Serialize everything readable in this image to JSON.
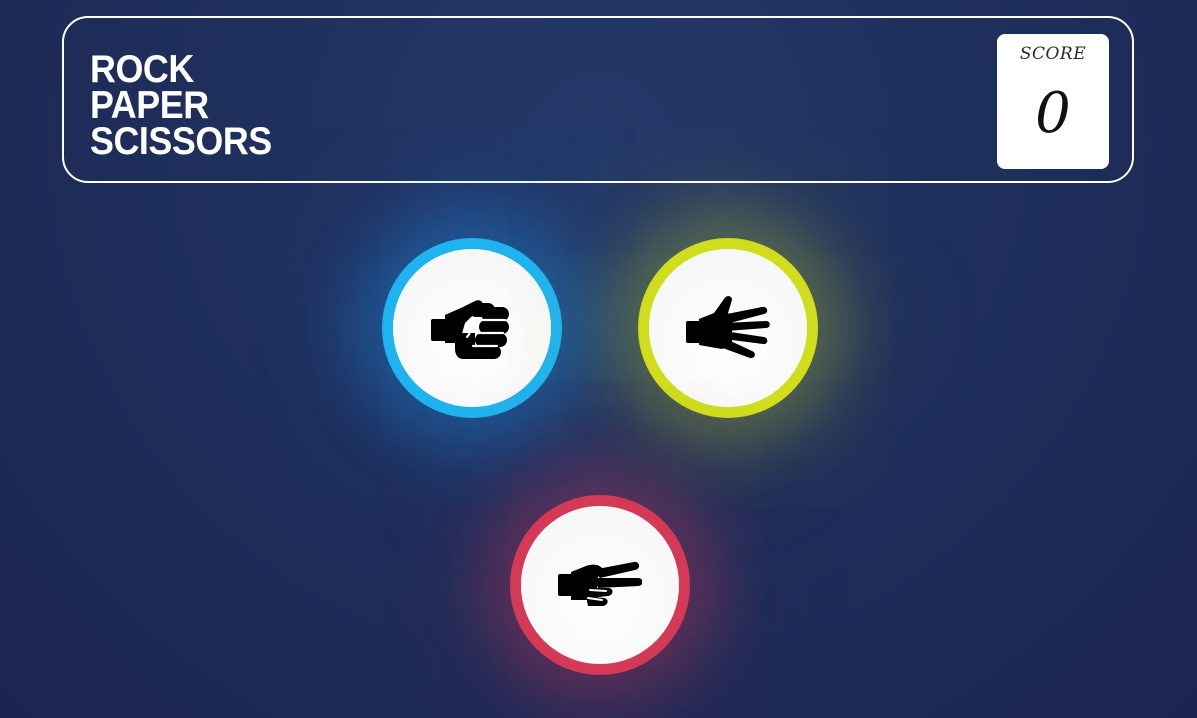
{
  "header": {
    "title_lines": [
      "ROCK",
      "PAPER",
      "SCISSORS"
    ],
    "score_label": "SCORE",
    "score_value": "0"
  },
  "choices": [
    {
      "id": "rock",
      "icon": "fist-icon",
      "ring_color": "#1fb4ef"
    },
    {
      "id": "paper",
      "icon": "open-hand-icon",
      "ring_color": "#cfdd1c"
    },
    {
      "id": "scissors",
      "icon": "peace-hand-icon",
      "ring_color": "#d43a55"
    }
  ]
}
